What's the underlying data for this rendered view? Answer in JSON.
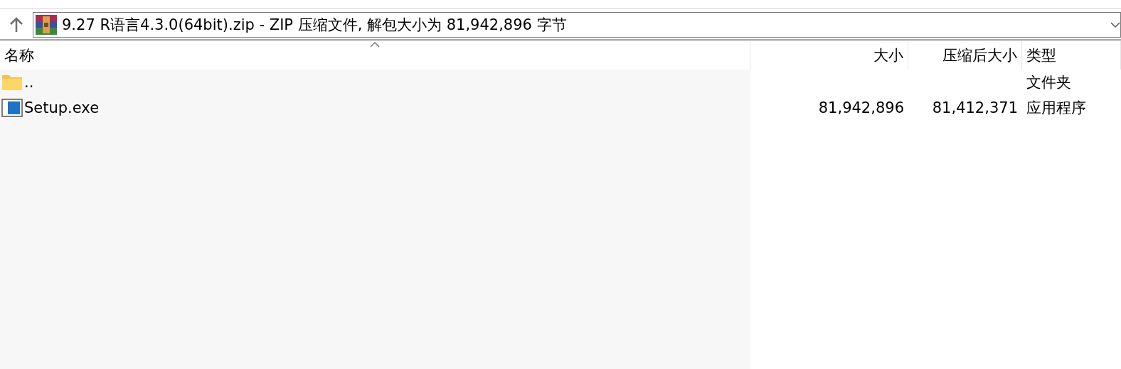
{
  "address_bar": {
    "path": "9.27 R语言4.3.0(64bit).zip - ZIP 压缩文件, 解包大小为 81,942,896 字节"
  },
  "table": {
    "columns": [
      {
        "label": "名称",
        "sorted": true
      },
      {
        "label": "大小",
        "sorted": false
      },
      {
        "label": "压缩后大小",
        "sorted": false
      },
      {
        "label": "类型",
        "sorted": false
      }
    ],
    "rows": [
      {
        "kind": "folder",
        "name": "..",
        "size": "",
        "packed": "",
        "type": "文件夹"
      },
      {
        "kind": "exe",
        "name": "Setup.exe",
        "size": "81,942,896",
        "packed": "81,412,371",
        "type": "应用程序"
      }
    ]
  }
}
